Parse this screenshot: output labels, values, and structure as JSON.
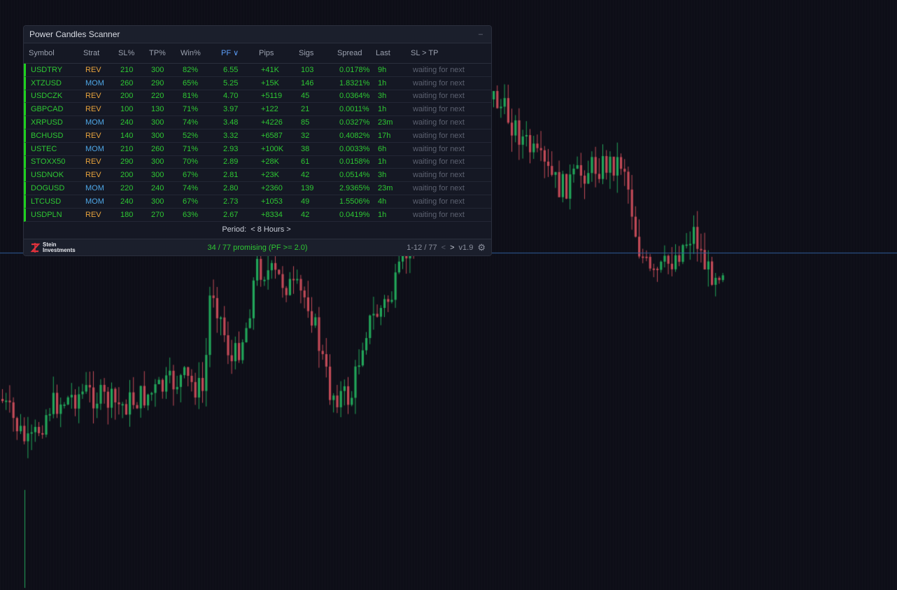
{
  "panel": {
    "title": "Power Candles Scanner",
    "minimize_label": "–",
    "columns": [
      "Symbol",
      "Strat",
      "SL%",
      "TP%",
      "Win%",
      "PF ∨",
      "Pips",
      "Sigs",
      "Spread",
      "Last",
      "SL > TP"
    ],
    "rows": [
      {
        "symbol": "USDTRY",
        "strat": "REV",
        "sl": "210",
        "tp": "300",
        "win": "82%",
        "pf": "6.55",
        "pips": "+41K",
        "sigs": "103",
        "spread": "0.0178%",
        "last": "9h",
        "status": "waiting for next"
      },
      {
        "symbol": "XTZUSD",
        "strat": "MOM",
        "sl": "260",
        "tp": "290",
        "win": "65%",
        "pf": "5.25",
        "pips": "+15K",
        "sigs": "146",
        "spread": "1.8321%",
        "last": "1h",
        "status": "waiting for next"
      },
      {
        "symbol": "USDCZK",
        "strat": "REV",
        "sl": "200",
        "tp": "220",
        "win": "81%",
        "pf": "4.70",
        "pips": "+5119",
        "sigs": "45",
        "spread": "0.0364%",
        "last": "3h",
        "status": "waiting for next"
      },
      {
        "symbol": "GBPCAD",
        "strat": "REV",
        "sl": "100",
        "tp": "130",
        "win": "71%",
        "pf": "3.97",
        "pips": "+122",
        "sigs": "21",
        "spread": "0.0011%",
        "last": "1h",
        "status": "waiting for next"
      },
      {
        "symbol": "XRPUSD",
        "strat": "MOM",
        "sl": "240",
        "tp": "300",
        "win": "74%",
        "pf": "3.48",
        "pips": "+4226",
        "sigs": "85",
        "spread": "0.0327%",
        "last": "23m",
        "status": "waiting for next"
      },
      {
        "symbol": "BCHUSD",
        "strat": "REV",
        "sl": "140",
        "tp": "300",
        "win": "52%",
        "pf": "3.32",
        "pips": "+6587",
        "sigs": "32",
        "spread": "0.4082%",
        "last": "17h",
        "status": "waiting for next"
      },
      {
        "symbol": "USTEC",
        "strat": "MOM",
        "sl": "210",
        "tp": "260",
        "win": "71%",
        "pf": "2.93",
        "pips": "+100K",
        "sigs": "38",
        "spread": "0.0033%",
        "last": "6h",
        "status": "waiting for next"
      },
      {
        "symbol": "STOXX50",
        "strat": "REV",
        "sl": "290",
        "tp": "300",
        "win": "70%",
        "pf": "2.89",
        "pips": "+28K",
        "sigs": "61",
        "spread": "0.0158%",
        "last": "1h",
        "status": "waiting for next"
      },
      {
        "symbol": "USDNOK",
        "strat": "REV",
        "sl": "200",
        "tp": "300",
        "win": "67%",
        "pf": "2.81",
        "pips": "+23K",
        "sigs": "42",
        "spread": "0.0514%",
        "last": "3h",
        "status": "waiting for next"
      },
      {
        "symbol": "DOGUSD",
        "strat": "MOM",
        "sl": "220",
        "tp": "240",
        "win": "74%",
        "pf": "2.80",
        "pips": "+2360",
        "sigs": "139",
        "spread": "2.9365%",
        "last": "23m",
        "status": "waiting for next"
      },
      {
        "symbol": "LTCUSD",
        "strat": "MOM",
        "sl": "240",
        "tp": "300",
        "win": "67%",
        "pf": "2.73",
        "pips": "+1053",
        "sigs": "49",
        "spread": "1.5506%",
        "last": "4h",
        "status": "waiting for next"
      },
      {
        "symbol": "USDPLN",
        "strat": "REV",
        "sl": "180",
        "tp": "270",
        "win": "63%",
        "pf": "2.67",
        "pips": "+8334",
        "sigs": "42",
        "spread": "0.0419%",
        "last": "1h",
        "status": "waiting for next"
      }
    ],
    "period_label": "Period:",
    "period_prev": "<",
    "period_value": "8 Hours",
    "period_next": ">",
    "brand_line1": "Stein",
    "brand_line2": "Investments",
    "promising_text": "34 / 77 promising (PF >= 2.0)",
    "page_range": "1-12 / 77",
    "page_prev": "<",
    "page_next": ">",
    "version": "v1.9"
  },
  "colors": {
    "background": "#0d0e17",
    "bull": "#22a65a",
    "bear": "#c24a57",
    "positive": "#2ec833",
    "rev": "#e6a23c",
    "mom": "#4ea7e6",
    "price_line": "#2f5f9e"
  },
  "icons": {
    "settings": "gear-icon",
    "brand": "stein-logo-icon"
  }
}
